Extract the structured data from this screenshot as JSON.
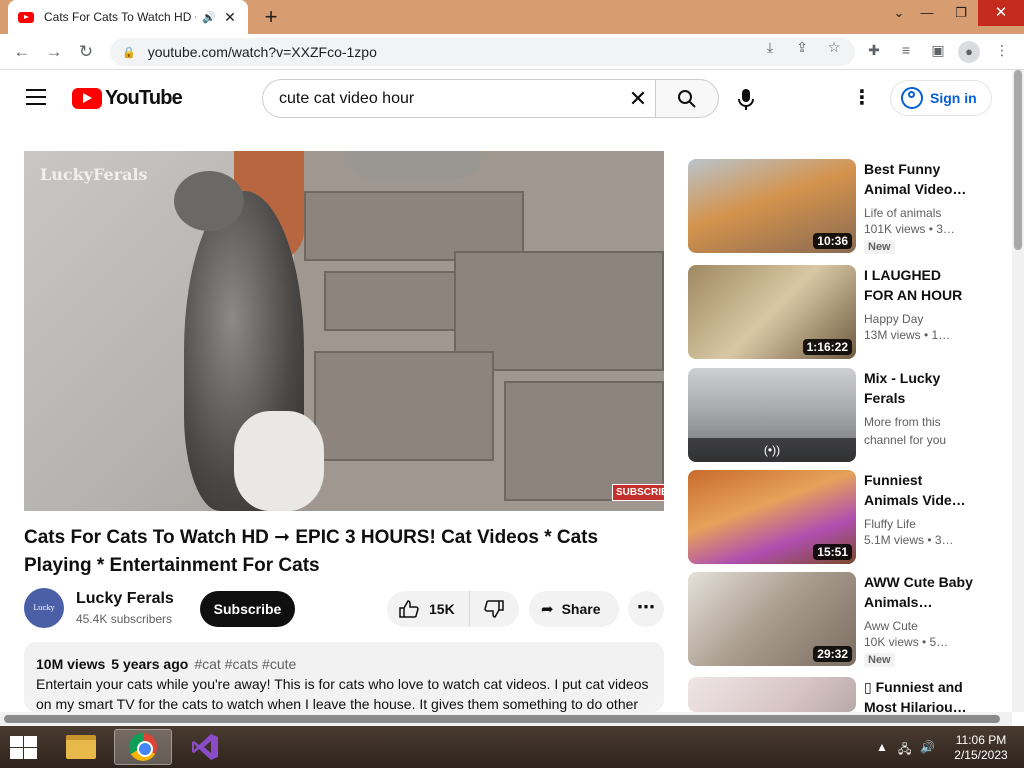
{
  "browser": {
    "tab_title": "Cats For Cats To Watch HD ➞",
    "url": "youtube.com/watch?v=XXZFco-1zpo"
  },
  "header": {
    "logo_text": "YouTube",
    "search_query": "cute cat video hour",
    "sign_in": "Sign in"
  },
  "player": {
    "watermark": "LuckyFerals",
    "subscribe_stamp": "SUBSCRIBE"
  },
  "video": {
    "title": "Cats For Cats To Watch HD ➞ EPIC 3 HOURS! Cat Videos * Cats Playing * Entertainment For Cats",
    "channel": "Lucky Ferals",
    "channel_avatar_text": "Lucky Ferals",
    "subscribers": "45.4K subscribers",
    "subscribe_label": "Subscribe",
    "likes": "15K",
    "share_label": "Share",
    "views": "10M views",
    "age": "5 years ago",
    "tags": "#cat #cats #cute",
    "description": "Entertain your cats while you're away! This is for cats who love to watch cat videos. I put cat videos on my smart TV for the cats to watch when I leave the house. It gives them something to do other"
  },
  "recommendations": [
    {
      "title": "Best Funny Animal Video…",
      "channel": "Life of animals",
      "views": "101K views  • 3…",
      "duration": "10:36",
      "badge": "New"
    },
    {
      "title": "I LAUGHED FOR AN HOUR🙀…",
      "channel": "Happy Day",
      "views": "13M views  • 1…",
      "duration": "1:16:22",
      "badge": ""
    },
    {
      "title": "Mix - Lucky Ferals",
      "channel": "More from this channel for you",
      "views": "",
      "duration": "(•))",
      "badge": ""
    },
    {
      "title": "Funniest Animals Vide…",
      "channel": "Fluffy Life",
      "views": "5.1M views  • 3…",
      "duration": "15:51",
      "badge": ""
    },
    {
      "title": "AWW Cute Baby Animals…",
      "channel": "Aww Cute",
      "views": "10K views  • 5…",
      "duration": "29:32",
      "badge": "New"
    },
    {
      "title": "▯ Funniest and Most Hilariou…",
      "channel": "",
      "views": "",
      "duration": "",
      "badge": ""
    }
  ],
  "taskbar": {
    "time": "11:06 PM",
    "date": "2/15/2023"
  },
  "colors": {
    "brand_red": "#ff0000",
    "link_blue": "#065fd4",
    "titlebar": "#d79c6f"
  }
}
